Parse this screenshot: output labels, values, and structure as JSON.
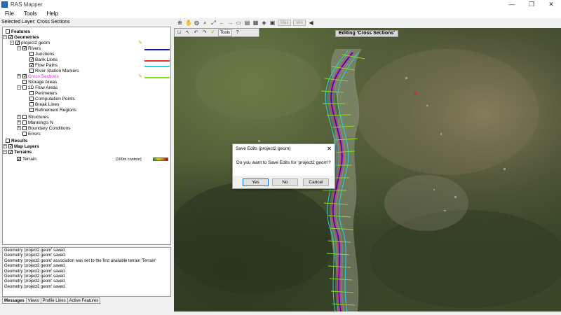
{
  "window": {
    "title": "RAS Mapper",
    "min": "—",
    "max": "❐",
    "close": "✕"
  },
  "menu": [
    "File",
    "Tools",
    "Help"
  ],
  "selected_layer": "Selected Layer: Cross Sections",
  "toolbar": {
    "max_label": "Max",
    "min_label": "Min"
  },
  "tree": {
    "features": "Features",
    "geometries": "Geometries",
    "project2_geom": "project2 geom",
    "rivers": "Rivers",
    "junctions": "Junctions",
    "bank_lines": "Bank Lines",
    "flow_paths": "Flow Paths",
    "river_station_markers": "River Station Markers",
    "cross_sections": "Cross Sections",
    "storage_areas": "Storage Areas",
    "flow_areas_2d": "2D Flow Areas",
    "perimeters": "Perimeters",
    "computation_points": "Computation Points",
    "break_lines": "Break Lines",
    "refinement_regions": "Refinement Regions",
    "structures": "Structures",
    "mannings_n": "Manning's N",
    "boundary_conditions": "Boundary Conditions",
    "errors": "Errors",
    "results": "Results",
    "map_layers": "Map Layers",
    "terrains": "Terrains",
    "terrain": "Terrain",
    "terrain_contour": "[100m contour]"
  },
  "colors": {
    "river": "#1a1aa0",
    "bank_lines": "#e03030",
    "flow_paths": "#30d0e0",
    "cross_sections": "#80e020",
    "highlight": "#e020e0"
  },
  "messages": [
    "Geometry 'project2 geom' saved.",
    "Geometry 'project2 geom' saved.",
    "Geometry 'project2 geom' association was set to the first available terrain 'Terrain'",
    "Geometry 'project2 geom' saved.",
    "Geometry 'project2 geom' saved.",
    "Geometry 'project2 geom' saved.",
    "Geometry 'project2 geom' saved.",
    "Geometry 'project2 geom' saved."
  ],
  "tabs": [
    "Messages",
    "Views",
    "Profile Lines",
    "Active Features"
  ],
  "map_toolbar": {
    "tools_label": "Tools",
    "help_label": "?"
  },
  "edit_banner": "Editing 'Cross Sections'",
  "dialog": {
    "title": "Save Edits (project2 geom)",
    "message": "Do you want to Save Edits for 'project2 geom'?",
    "yes": "Yes",
    "no": "No",
    "cancel": "Cancel"
  }
}
